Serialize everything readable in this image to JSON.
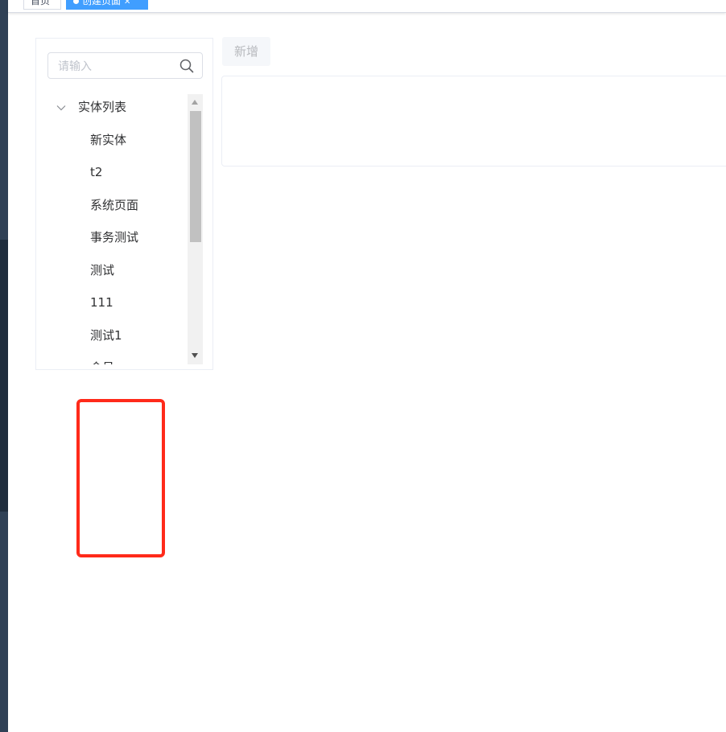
{
  "tags": [
    {
      "label": "首页"
    },
    {
      "label": "创建页面"
    }
  ],
  "search": {
    "placeholder": "请输入",
    "value": ""
  },
  "tree": {
    "root": {
      "label": "实体列表",
      "expanded": true
    },
    "children": [
      {
        "label": "新实体"
      },
      {
        "label": "t2"
      },
      {
        "label": "系统页面"
      },
      {
        "label": "事务测试"
      },
      {
        "label": "测试"
      },
      {
        "label": "111"
      },
      {
        "label": "测试1"
      },
      {
        "label": "会员"
      }
    ]
  },
  "toolbar": {
    "add_label": "新增",
    "add_disabled": true
  },
  "colors": {
    "accent": "#409eff",
    "annotation": "#ff2a1a",
    "sidebar": "#304156"
  }
}
